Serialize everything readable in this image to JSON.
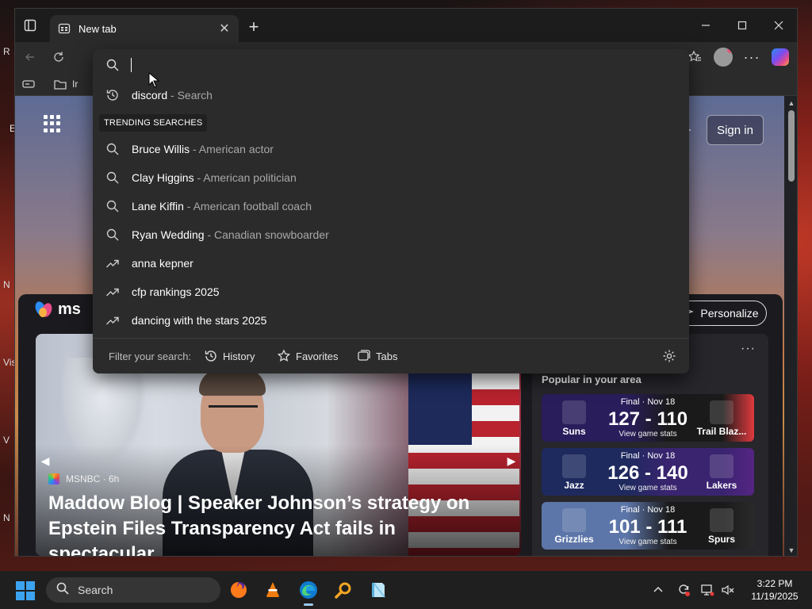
{
  "desktop": {
    "fragments": [
      "R",
      "E",
      "N",
      "Vis",
      "V",
      "N"
    ]
  },
  "browser": {
    "tab": {
      "title": "New tab"
    },
    "favbar": {
      "item_label": "Ir"
    },
    "address": {
      "value": "",
      "placeholder": ""
    },
    "suggestions": {
      "recent": [
        {
          "query": "discord",
          "suffix": " - Search"
        }
      ],
      "trending_label": "TRENDING SEARCHES",
      "trending": [
        {
          "query": "Bruce Willis",
          "suffix": " - American actor",
          "icon": "search-icon"
        },
        {
          "query": "Clay Higgins",
          "suffix": " - American politician",
          "icon": "search-icon"
        },
        {
          "query": "Lane Kiffin",
          "suffix": " - American football coach",
          "icon": "search-icon"
        },
        {
          "query": "Ryan Wedding",
          "suffix": " - Canadian snowboarder",
          "icon": "search-icon"
        },
        {
          "query": "anna kepner",
          "suffix": "",
          "icon": "trending-icon"
        },
        {
          "query": "cfp rankings 2025",
          "suffix": "",
          "icon": "trending-icon"
        },
        {
          "query": "dancing with the stars 2025",
          "suffix": "",
          "icon": "trending-icon"
        }
      ],
      "filter_label": "Filter your search:",
      "filters": {
        "history": "History",
        "favorites": "Favorites",
        "tabs": "Tabs"
      }
    },
    "page": {
      "sign_in": "Sign in",
      "msn_text": "ms",
      "personalize": "Personalize",
      "more": "···",
      "hero": {
        "source": "MSNBC · 6h",
        "title": "Maddow Blog | Speaker Johnson’s strategy on Epstein Files Transparency Act fails in spectacular..."
      },
      "side": {
        "title": "Popular in your area",
        "games": [
          {
            "status": "Final · Nov 18",
            "score": "127 - 110",
            "stats": "View game stats",
            "home": "Suns",
            "away": "Trail Blaz...",
            "home_color": "#2a1d5c",
            "away_color": "#1a1a1a",
            "accent": "#e03a3e",
            "home_arrow": "left"
          },
          {
            "status": "Final · Nov 18",
            "score": "126 - 140",
            "stats": "View game stats",
            "home": "Jazz",
            "away": "Lakers",
            "home_color": "#1e2a5e",
            "away_color": "#3a2470",
            "accent": "#552583",
            "home_arrow": "right"
          },
          {
            "status": "Final · Nov 18",
            "score": "101 - 111",
            "stats": "View game stats",
            "home": "Grizzlies",
            "away": "Spurs",
            "home_color": "#5d76a9",
            "away_color": "#1a1a1a",
            "accent": "#2a2a2a",
            "home_arrow": "right"
          }
        ]
      }
    }
  },
  "taskbar": {
    "search_label": "Search",
    "time": "3:22 PM",
    "date": "11/19/2025"
  }
}
